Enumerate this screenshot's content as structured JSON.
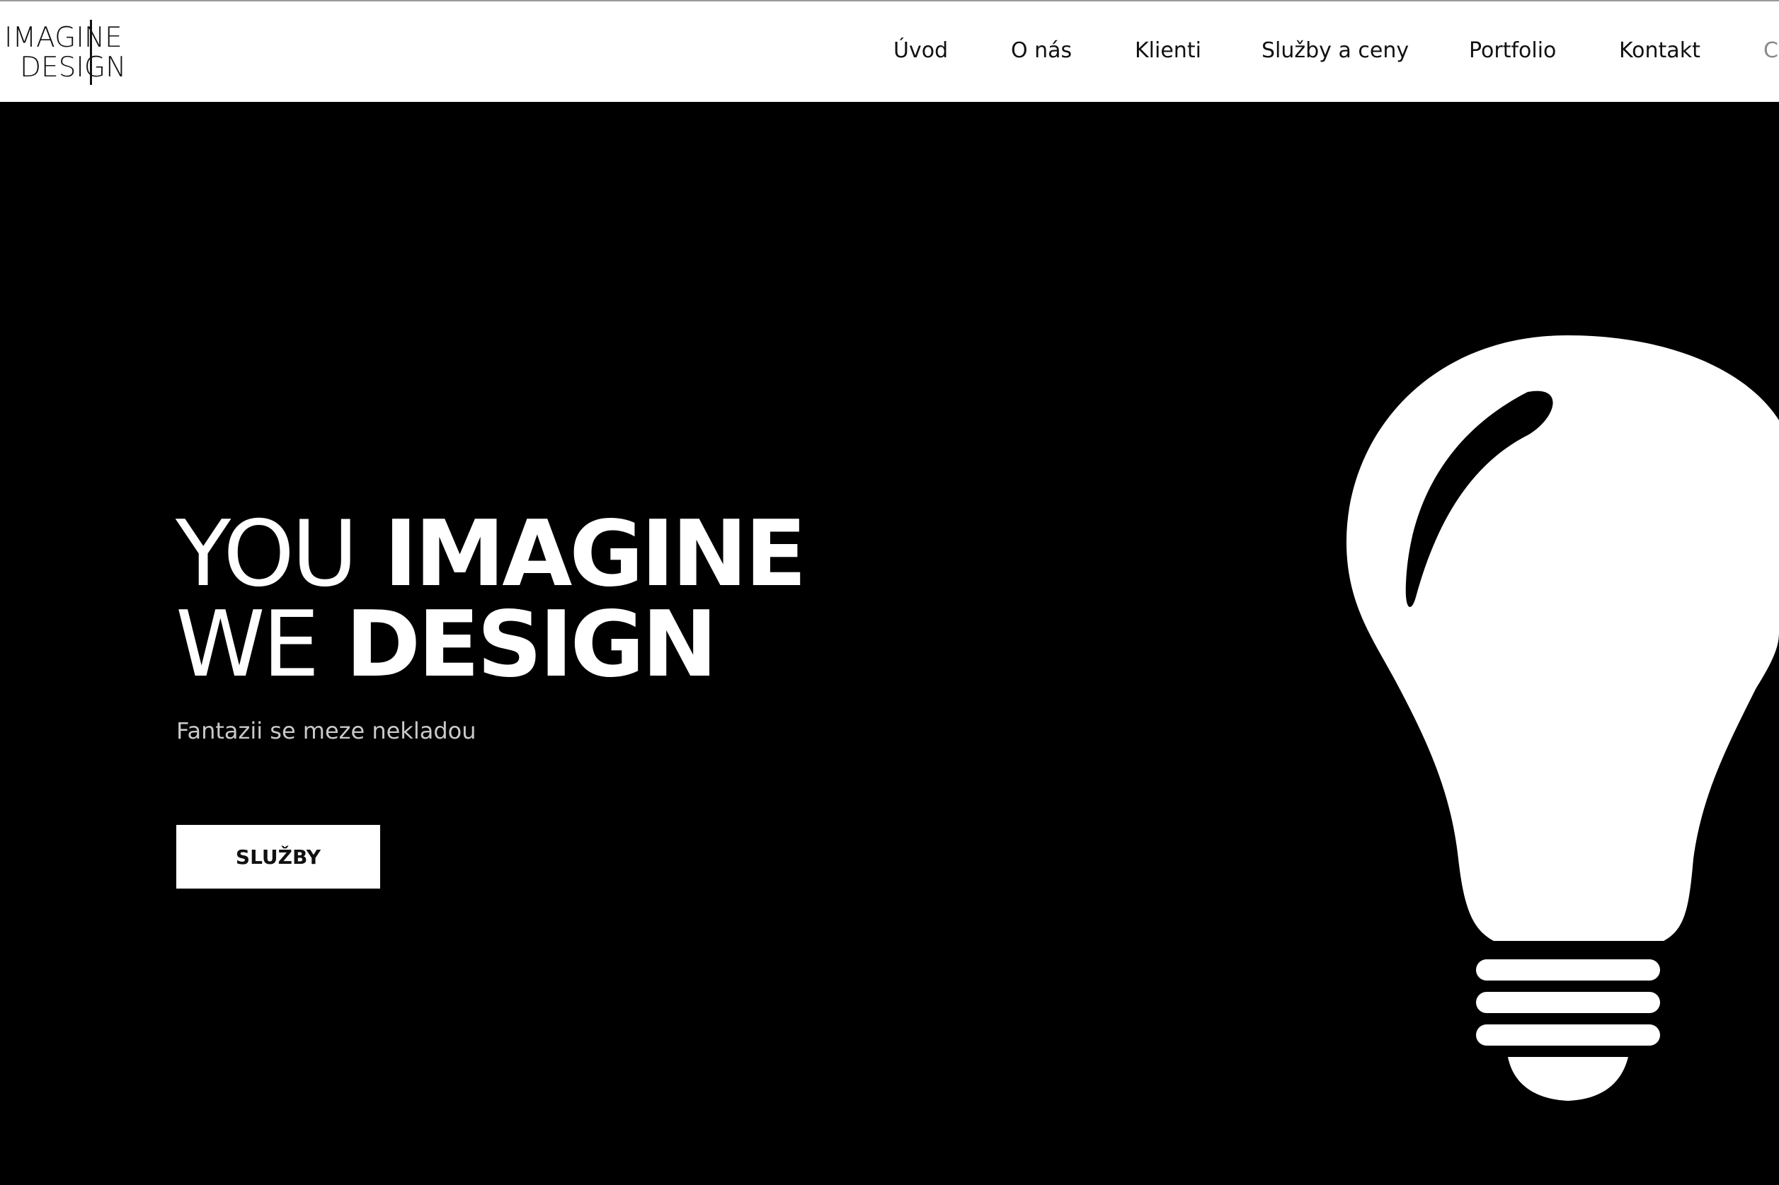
{
  "logo": {
    "line1": "IMAGINE",
    "line2": "DESIGN"
  },
  "nav": {
    "items": [
      {
        "label": "Úvod"
      },
      {
        "label": "O nás"
      },
      {
        "label": "Klienti"
      },
      {
        "label": "Služby a ceny"
      },
      {
        "label": "Portfolio"
      },
      {
        "label": "Kontakt"
      },
      {
        "label": "C"
      }
    ]
  },
  "hero": {
    "line1_thin": "YOU",
    "line1_bold": "IMAGINE",
    "line2_thin": "WE",
    "line2_bold": "DESIGN",
    "tagline": "Fantazii se meze nekladou",
    "cta_label": "SLUŽBY"
  },
  "colors": {
    "background": "#000000",
    "header": "#ffffff",
    "text_light": "#ffffff",
    "text_dark": "#111111"
  },
  "icons": {
    "hero_illustration": "lightbulb-icon"
  }
}
